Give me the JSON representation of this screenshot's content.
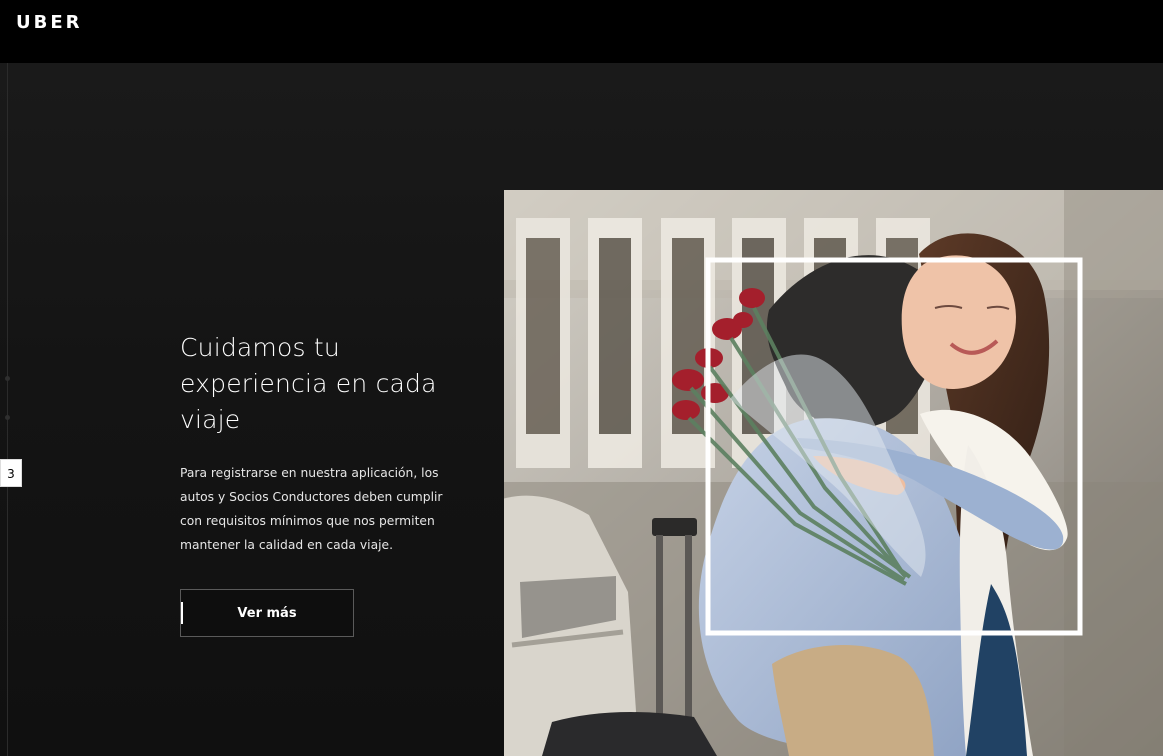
{
  "header": {
    "logo": "UBER"
  },
  "slider": {
    "current_slide": "3"
  },
  "hero": {
    "title": "Cuidamos tu experiencia en cada viaje",
    "description": "Para registrarse en nuestra aplicación, los autos y Socios Conductores deben cumplir con requisitos mínimos que nos permiten mantener la calidad en cada viaje.",
    "cta_label": "Ver más"
  },
  "colors": {
    "background": "#000000",
    "hero_background": "#141414",
    "text": "#ffffff",
    "cta_border": "#5a5a5a",
    "frame": "#ffffff"
  }
}
